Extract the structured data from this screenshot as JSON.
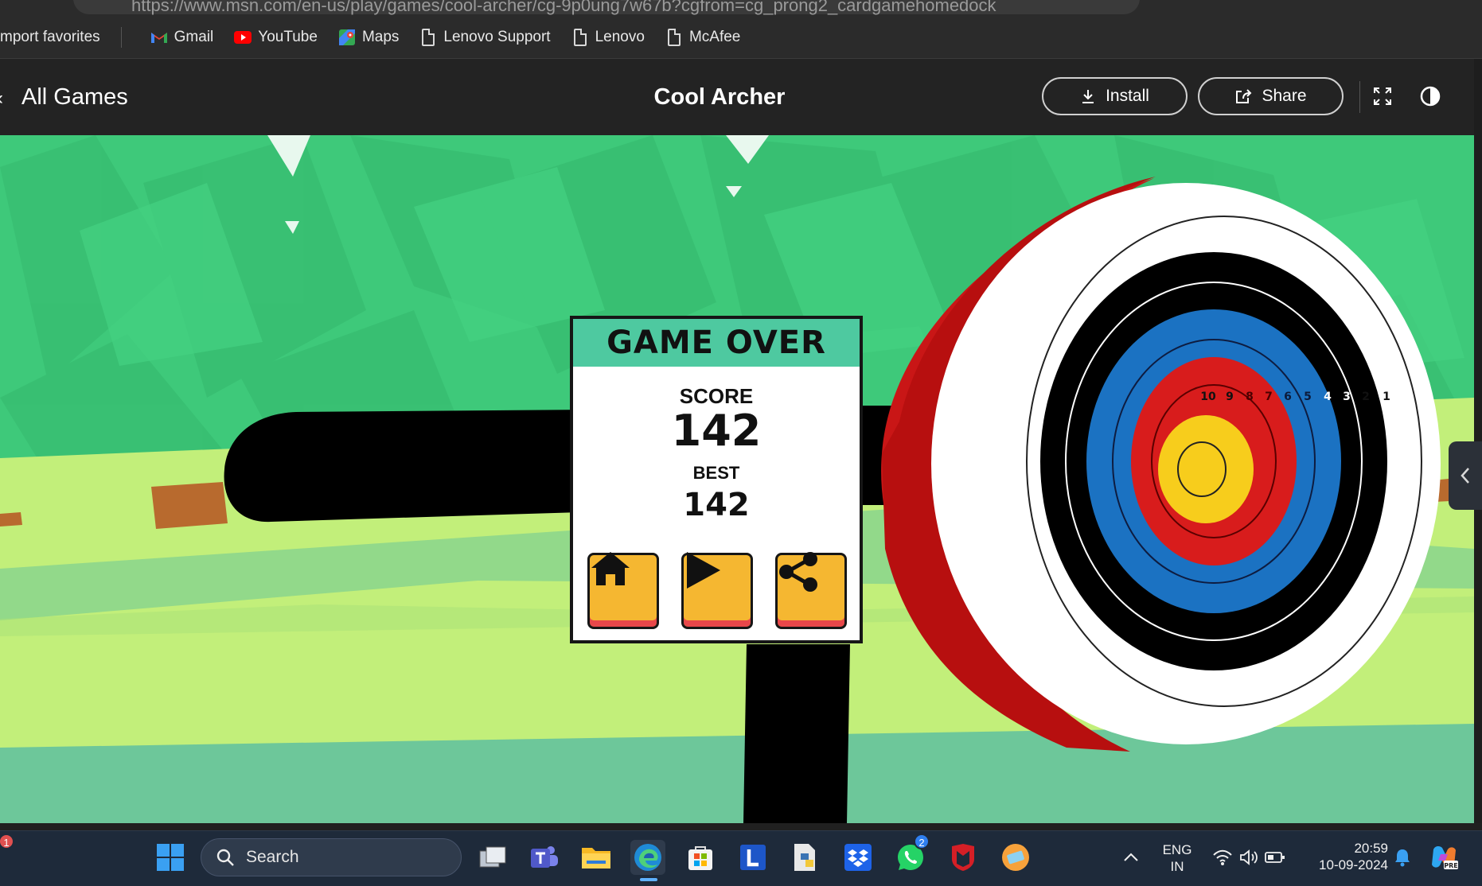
{
  "browser": {
    "url_partial": "https://www.msn.com/en-us/play/games/cool-archer/cg-9p0ung7w67b?cgfrom=cg_prong2_cardgamehomedock"
  },
  "favorites": {
    "items": [
      {
        "label": "mport favorites",
        "icon": "import-icon"
      },
      {
        "label": "Gmail",
        "icon": "gmail-icon"
      },
      {
        "label": "YouTube",
        "icon": "youtube-icon"
      },
      {
        "label": "Maps",
        "icon": "maps-icon"
      },
      {
        "label": "Lenovo Support",
        "icon": "page-icon"
      },
      {
        "label": "Lenovo",
        "icon": "page-icon"
      },
      {
        "label": "McAfee",
        "icon": "page-icon"
      }
    ]
  },
  "game_header": {
    "back_label": "All Games",
    "title": "Cool Archer",
    "install_label": "Install",
    "share_label": "Share"
  },
  "dialog": {
    "title": "GAME OVER",
    "score_label": "SCORE",
    "score_value": "142",
    "best_label": "BEST",
    "best_value": "142"
  },
  "target": {
    "ring_numbers": [
      "10",
      "9",
      "8",
      "7",
      "6",
      "5",
      "4",
      "3",
      "2",
      "1"
    ]
  },
  "taskbar": {
    "search_placeholder": "Search",
    "notification_count": "1",
    "whatsapp_badge": "2",
    "language": "ENG",
    "region": "IN",
    "time": "20:59",
    "date": "10-09-2024"
  },
  "colors": {
    "grass": "#3ec97a",
    "field": "#c2ef7a",
    "path": "#6dc79a",
    "dialog_header": "#4ec9a0",
    "button_fill": "#f5b731",
    "target_red": "#d81c1c",
    "target_blue": "#1b72c2",
    "target_gold": "#f7cd1c"
  }
}
